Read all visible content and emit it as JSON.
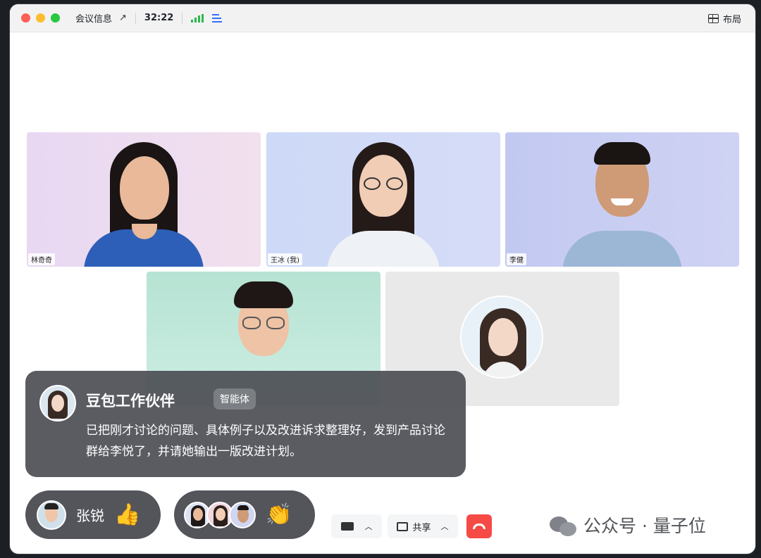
{
  "titlebar": {
    "meeting_info": "会议信息",
    "timer": "32:22",
    "layout_label": "布局"
  },
  "participants": [
    {
      "name": "林奇奇"
    },
    {
      "name": "王冰 (我)"
    },
    {
      "name": "李健"
    }
  ],
  "ai_card": {
    "name": "豆包工作伙伴",
    "badge": "智能体",
    "message": "已把刚才讨论的问题、具体例子以及改进诉求整理好，发到产品讨论群给李悦了，并请她输出一版改进计划。"
  },
  "reactions": {
    "single": {
      "name": "张锐",
      "emoji": "👍"
    },
    "group": {
      "emoji": "👏"
    }
  },
  "toolbar": {
    "share_label": "共享"
  },
  "watermark": {
    "text": "公众号 · 量子位"
  },
  "colors": {
    "end_call": "#f54a45",
    "accent": "#3370ff",
    "signal": "#2db84d"
  }
}
